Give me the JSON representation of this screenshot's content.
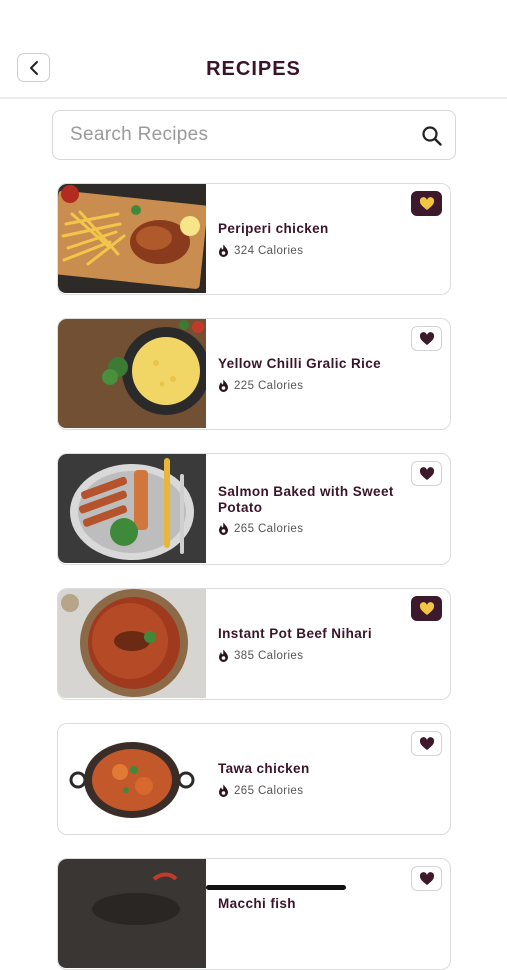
{
  "header": {
    "title": "RECIPES",
    "back_icon": "chevron-left-icon"
  },
  "search": {
    "placeholder": "Search Recipes",
    "icon": "search-icon"
  },
  "colors": {
    "accent": "#3c1a2c",
    "favorite_active": "#f4c542",
    "border": "#dcdcdc"
  },
  "recipes": [
    {
      "name": "Periperi chicken",
      "calories": "324 Calories",
      "favorite": true
    },
    {
      "name": "Yellow Chilli Gralic Rice",
      "calories": "225 Calories",
      "favorite": false
    },
    {
      "name": "Salmon Baked with Sweet Potato",
      "calories": "265 Calories",
      "favorite": false
    },
    {
      "name": "Instant Pot Beef Nihari",
      "calories": "385 Calories",
      "favorite": true
    },
    {
      "name": "Tawa chicken",
      "calories": "265 Calories",
      "favorite": false
    },
    {
      "name": "Macchi fish",
      "calories": "",
      "favorite": false
    }
  ]
}
